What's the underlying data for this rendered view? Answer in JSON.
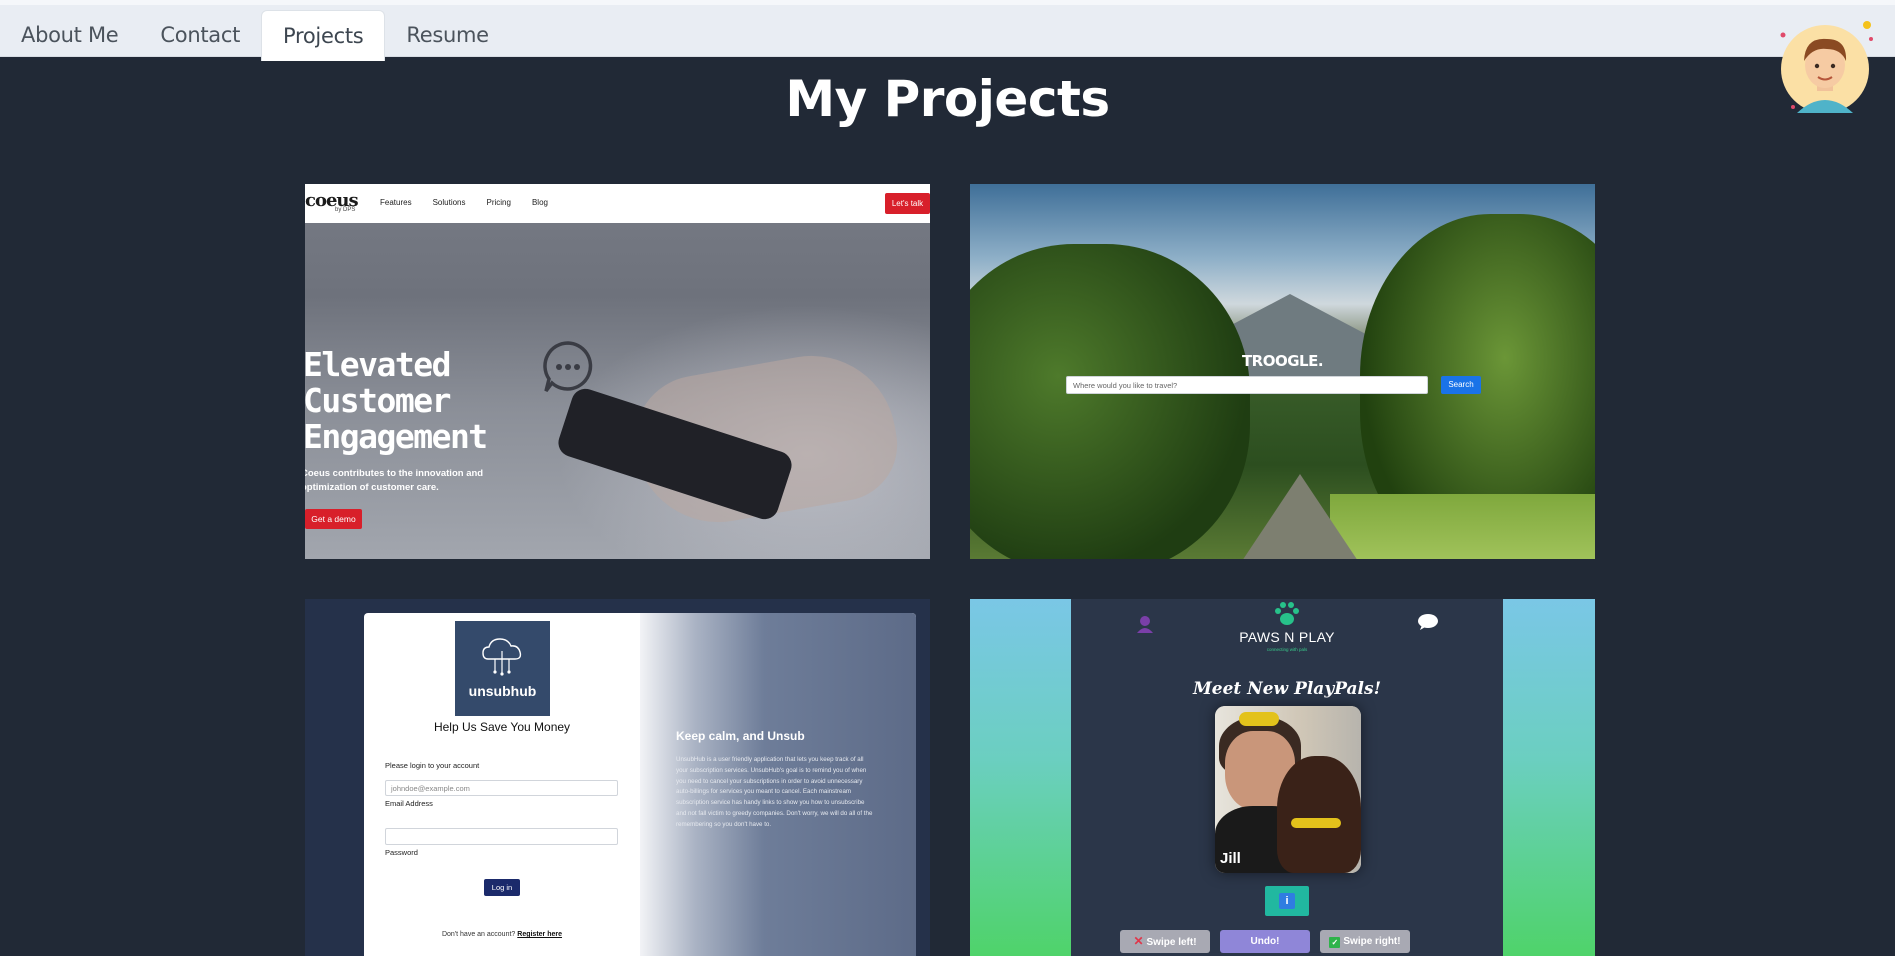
{
  "nav": {
    "tabs": [
      {
        "label": "About Me",
        "active": false
      },
      {
        "label": "Contact",
        "active": false
      },
      {
        "label": "Projects",
        "active": true
      },
      {
        "label": "Resume",
        "active": false
      }
    ]
  },
  "page": {
    "title": "My Projects"
  },
  "projects": {
    "coeus": {
      "logo": "coeus",
      "logo_sub": "by DPS",
      "nav_links": [
        "Features",
        "Solutions",
        "Pricing",
        "Blog"
      ],
      "cta": "Let's talk",
      "headline": "Elevated Customer Engagement",
      "subtext": "Coeus contributes to the innovation and optimization of customer care.",
      "demo_button": "Get a demo"
    },
    "troogle": {
      "brand": "TROOGLE.",
      "search_placeholder": "Where would you like to travel?",
      "search_button": "Search"
    },
    "unsubhub": {
      "logo_text": "unsubhub",
      "heading": "Help Us Save You Money",
      "prompt": "Please login to your account",
      "email_placeholder": "johndoe@example.com",
      "email_label": "Email Address",
      "password_label": "Password",
      "login_button": "Log in",
      "no_account": "Don't have an account?",
      "register_link": "Register here",
      "right_title": "Keep calm, and Unsub",
      "right_desc": "UnsubHub is a user friendly application that lets you keep track of all your subscription services. UnsubHub's goal is to remind you of when you need to cancel your subscriptions in order to avoid unnecessary auto-billings for services you meant to cancel. Each mainstream subscription service has handy links to show you how to unsubscribe and not fall victim to greedy companies. Don't worry, we will do all of the remembering so you don't have to."
    },
    "paws": {
      "brand": "PAWS N PLAY",
      "brand_sub": "connecting with pals",
      "heading": "Meet New PlayPals!",
      "pet_name": "Jill",
      "info_icon": "i",
      "swipe_left": "Swipe left!",
      "undo": "Undo!",
      "swipe_right": "Swipe right!"
    }
  },
  "colors": {
    "background": "#212936",
    "nav_bg": "#e9edf3",
    "coeus_red": "#d81f2a",
    "troogle_blue": "#1a73e8",
    "paws_teal": "#21b8a0"
  }
}
